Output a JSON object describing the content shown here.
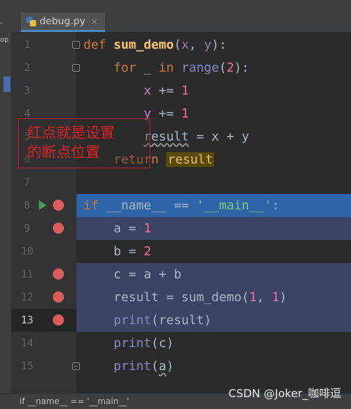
{
  "tab": {
    "filename": "debug.py",
    "close": "×"
  },
  "left_strip": {
    "top": "-",
    "tool": "op"
  },
  "lines": [
    {
      "num": "1"
    },
    {
      "num": "2"
    },
    {
      "num": "3"
    },
    {
      "num": "4"
    },
    {
      "num": "5"
    },
    {
      "num": "6"
    },
    {
      "num": "7"
    },
    {
      "num": "8"
    },
    {
      "num": "9"
    },
    {
      "num": "10"
    },
    {
      "num": "11"
    },
    {
      "num": "12"
    },
    {
      "num": "13"
    },
    {
      "num": "14"
    },
    {
      "num": "15"
    }
  ],
  "code": {
    "l1": {
      "kw": "def",
      "name": "sum_demo",
      "open": "(",
      "x": "x",
      "comma": ", ",
      "y": "y",
      "close": "):"
    },
    "l2": {
      "kw": "for",
      "under": " _ ",
      "in": "in",
      "fn": "range",
      "open": "(",
      "num": "2",
      "close": "):"
    },
    "l3": {
      "var": "x",
      "op": " += ",
      "num": "1"
    },
    "l4": {
      "var": "y",
      "op": " += ",
      "num": "1"
    },
    "l5": {
      "var": "result",
      "eq": " = ",
      "x": "x",
      "plus": " + ",
      "y": "y"
    },
    "l6": {
      "kw": "return",
      "var": "result"
    },
    "l8": {
      "kw": "if",
      "name": "__name__",
      "op": " == ",
      "str": "'__main__'",
      "colon": ":"
    },
    "l9": {
      "var": "a",
      "op": " = ",
      "num": "1"
    },
    "l10": {
      "var": "b",
      "op": " = ",
      "num": "2"
    },
    "l11": {
      "var": "c",
      "op": " = ",
      "a": "a",
      "plus": " + ",
      "b": "b"
    },
    "l12": {
      "var": "result",
      "op": " = ",
      "fn": "sum_demo",
      "open": "(",
      "n1": "1",
      "comma": ", ",
      "n2": "1",
      "close": ")"
    },
    "l13": {
      "fn": "print",
      "open": "(",
      "arg": "result",
      "close": ")"
    },
    "l14": {
      "fn": "print",
      "open": "(",
      "arg": "c",
      "close": ")"
    },
    "l15": {
      "fn": "print",
      "open": "(",
      "arg": "a",
      "close": ")"
    }
  },
  "annotation": {
    "line1": "红点就是设置",
    "line2": "的断点位置"
  },
  "statusbar": {
    "breadcrumb": "if __name__ == '__main__'"
  },
  "watermark": "CSDN @Joker_咖啡逗",
  "colors": {
    "breakpoint": "#db5c5c",
    "exec_line": "#2e65a8",
    "bp_line": "#3a4564",
    "annotation": "#e02020"
  }
}
